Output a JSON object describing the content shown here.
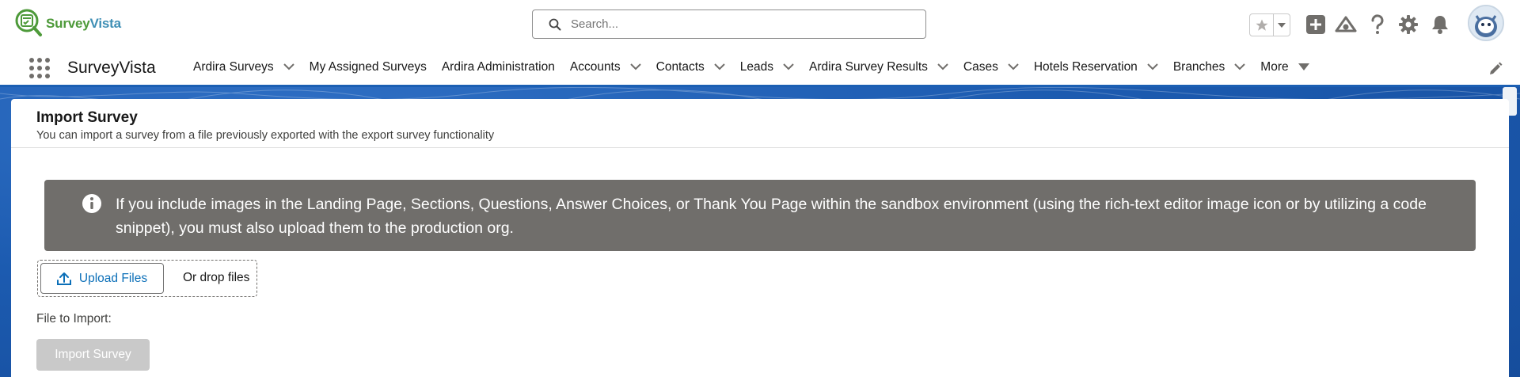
{
  "header": {
    "logo": {
      "part1": "Survey",
      "part2": "Vista"
    },
    "search": {
      "placeholder": "Search..."
    },
    "icons": [
      "favorites-star-icon",
      "favorites-dropdown-icon",
      "add-icon",
      "trailhead-icon",
      "help-icon",
      "setup-gear-icon",
      "notifications-bell-icon",
      "user-avatar"
    ]
  },
  "nav": {
    "app_name": "SurveyVista",
    "items": [
      {
        "label": "Ardira Surveys",
        "has_menu": true
      },
      {
        "label": "My Assigned Surveys",
        "has_menu": false
      },
      {
        "label": "Ardira Administration",
        "has_menu": false
      },
      {
        "label": "Accounts",
        "has_menu": true
      },
      {
        "label": "Contacts",
        "has_menu": true
      },
      {
        "label": "Leads",
        "has_menu": true
      },
      {
        "label": "Ardira Survey Results",
        "has_menu": true
      },
      {
        "label": "Cases",
        "has_menu": true
      },
      {
        "label": "Hotels Reservation",
        "has_menu": true
      },
      {
        "label": "Branches",
        "has_menu": true
      },
      {
        "label": "More",
        "has_menu": true
      }
    ]
  },
  "card": {
    "title": "Import Survey",
    "subtitle": "You can import a survey from a file previously exported with the export survey functionality",
    "alert": {
      "text": "If you include images in the Landing Page, Sections, Questions, Answer Choices, or Thank You Page within the sandbox environment (using the rich-text editor image icon or by utilizing a code snippet), you must also upload them to the production org."
    },
    "upload": {
      "button_label": "Upload Files",
      "drop_text": "Or drop files"
    },
    "file_label": "File to Import:",
    "import_button": "Import Survey"
  },
  "colors": {
    "brand_blue": "#1b5fb3",
    "alert_bg": "#706e6b",
    "link_blue": "#0b6fb8",
    "disabled_button": "#c9c9c9",
    "logo_green": "#4e9a3a",
    "logo_blue": "#3f8fb5"
  }
}
